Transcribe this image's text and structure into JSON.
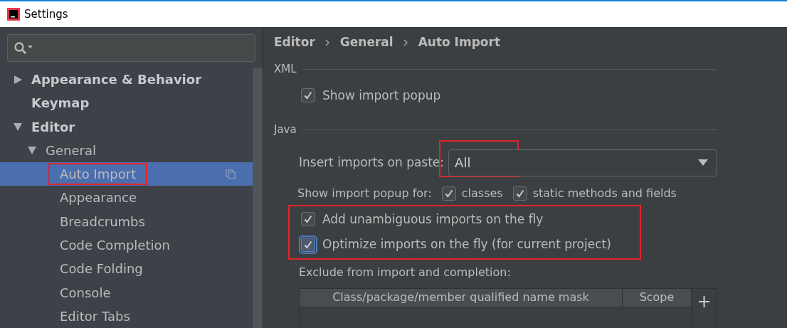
{
  "window": {
    "title": "Settings"
  },
  "tree": [
    {
      "label": "Appearance & Behavior",
      "expanded": false,
      "selected": false
    },
    {
      "label": "Keymap",
      "selected": false
    },
    {
      "label": "Editor",
      "expanded": true,
      "selected": false,
      "children": [
        {
          "label": "General",
          "expanded": true,
          "selected": false,
          "children": [
            {
              "label": "Auto Import",
              "selected": true,
              "highlighted": true
            },
            {
              "label": "Appearance",
              "selected": false
            },
            {
              "label": "Breadcrumbs",
              "selected": false
            },
            {
              "label": "Code Completion",
              "selected": false
            },
            {
              "label": "Code Folding",
              "selected": false
            },
            {
              "label": "Console",
              "selected": false
            },
            {
              "label": "Editor Tabs",
              "selected": false
            }
          ]
        }
      ]
    }
  ],
  "breadcrumb": [
    "Editor",
    "General",
    "Auto Import"
  ],
  "xml": {
    "title": "XML",
    "show_popup": {
      "label": "Show import popup",
      "checked": true
    }
  },
  "java": {
    "title": "Java",
    "insert_on_paste": {
      "label": "Insert imports on paste:",
      "value": "All",
      "highlighted": true
    },
    "show_popup_for": {
      "label": "Show import popup for:",
      "options": [
        {
          "label": "classes",
          "checked": true
        },
        {
          "label": "static methods and fields",
          "checked": true
        }
      ]
    },
    "fly_options": {
      "highlighted": true,
      "items": [
        {
          "label": "Add unambiguous imports on the fly",
          "checked": true,
          "focused": false
        },
        {
          "label": "Optimize imports on the fly (for current project)",
          "checked": true,
          "focused": true
        }
      ]
    },
    "exclude": {
      "label": "Exclude from import and completion:",
      "columns": [
        "Class/package/member qualified name mask",
        "Scope"
      ],
      "add_button": "+"
    }
  }
}
